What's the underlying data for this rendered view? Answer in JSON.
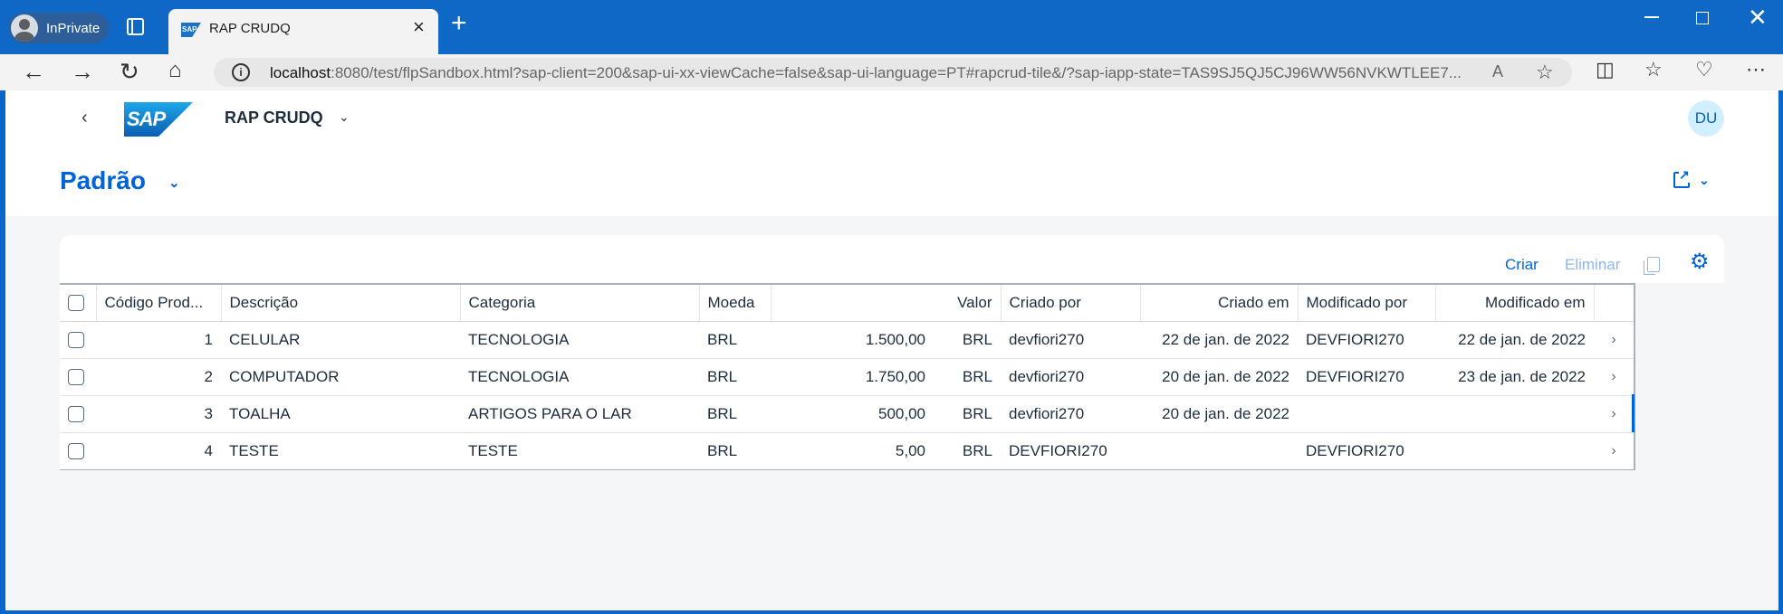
{
  "browser": {
    "inprivate_label": "InPrivate",
    "tab_title": "RAP CRUDQ",
    "favicon_text": "SAP",
    "url_host": "localhost",
    "url_rest": ":8080/test/flpSandbox.html?sap-client=200&sap-ui-xx-viewCache=false&sap-ui-language=PT#rapcrud-tile&/?sap-iapp-state=TAS9SJ5QJ5CJ96WW56NVKWTLEE7..."
  },
  "shell": {
    "logo_text": "SAP",
    "app_title": "RAP CRUDQ",
    "user_initials": "DU"
  },
  "header": {
    "variant_title": "Padrão"
  },
  "toolbar": {
    "create_label": "Criar",
    "delete_label": "Eliminar"
  },
  "table": {
    "columns": [
      "Código Prod...",
      "Descrição",
      "Categoria",
      "Moeda",
      "Valor",
      "Criado por",
      "Criado em",
      "Modificado por",
      "Modificado em"
    ],
    "rows": [
      {
        "code": "1",
        "desc": "CELULAR",
        "category": "TECNOLOGIA",
        "currency": "BRL",
        "value": "1.500,00",
        "value_currency": "BRL",
        "created_by": "devfiori270",
        "created_on": "22 de jan. de 2022",
        "modified_by": "DEVFIORI270",
        "modified_on": "22 de jan. de 2022"
      },
      {
        "code": "2",
        "desc": "COMPUTADOR",
        "category": "TECNOLOGIA",
        "currency": "BRL",
        "value": "1.750,00",
        "value_currency": "BRL",
        "created_by": "devfiori270",
        "created_on": "20 de jan. de 2022",
        "modified_by": "DEVFIORI270",
        "modified_on": "23 de jan. de 2022"
      },
      {
        "code": "3",
        "desc": "TOALHA",
        "category": "ARTIGOS PARA O LAR",
        "currency": "BRL",
        "value": "500,00",
        "value_currency": "BRL",
        "created_by": "devfiori270",
        "created_on": "20 de jan. de 2022",
        "modified_by": "",
        "modified_on": ""
      },
      {
        "code": "4",
        "desc": "TESTE",
        "category": "TESTE",
        "currency": "BRL",
        "value": "5,00",
        "value_currency": "BRL",
        "created_by": "DEVFIORI270",
        "created_on": "",
        "modified_by": "DEVFIORI270",
        "modified_on": ""
      }
    ]
  },
  "colors": {
    "accent": "#0064d9",
    "browser_frame": "#1068c6"
  }
}
